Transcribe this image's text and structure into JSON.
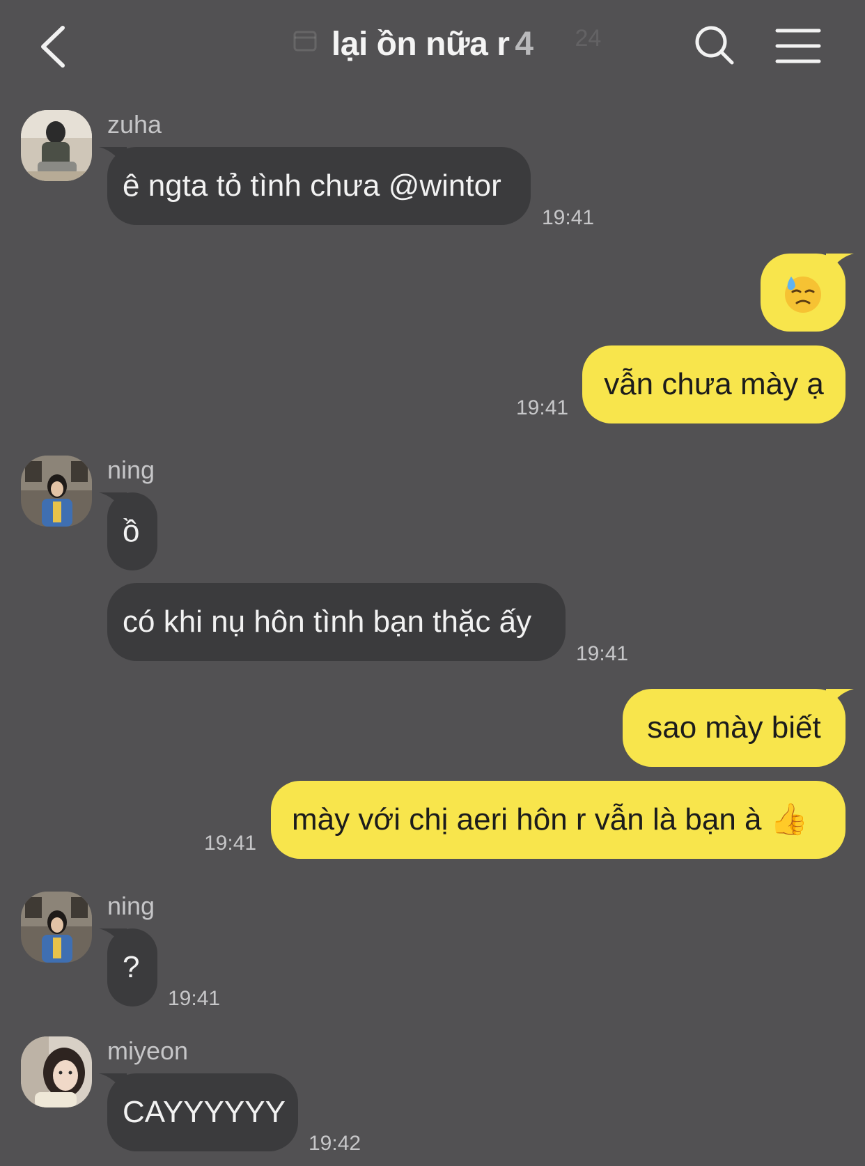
{
  "header": {
    "title": "lại ồn nữa r",
    "member_count": "4",
    "background_date": "24"
  },
  "colors": {
    "background": "#525153",
    "incoming_bubble": "#3b3b3d",
    "outgoing_bubble": "#f8e54c"
  },
  "messages": [
    {
      "sender": "zuha",
      "text": "ê ngta tỏ tình chưa @wintor",
      "time": "19:41"
    },
    {
      "text": "😓",
      "time": ""
    },
    {
      "text": "vẫn chưa mày ạ",
      "time": "19:41"
    },
    {
      "sender": "ning",
      "text": "ồ",
      "time": ""
    },
    {
      "text": "có khi nụ hôn tình bạn thặc ấy",
      "time": "19:41"
    },
    {
      "text": "sao mày biết",
      "time": ""
    },
    {
      "text": "mày với chị aeri hôn r vẫn là bạn à 👍",
      "time": "19:41"
    },
    {
      "sender": "ning",
      "text": "?",
      "time": "19:41"
    },
    {
      "sender": "miyeon",
      "text": "CAYYYYYY",
      "time": "19:42"
    }
  ]
}
